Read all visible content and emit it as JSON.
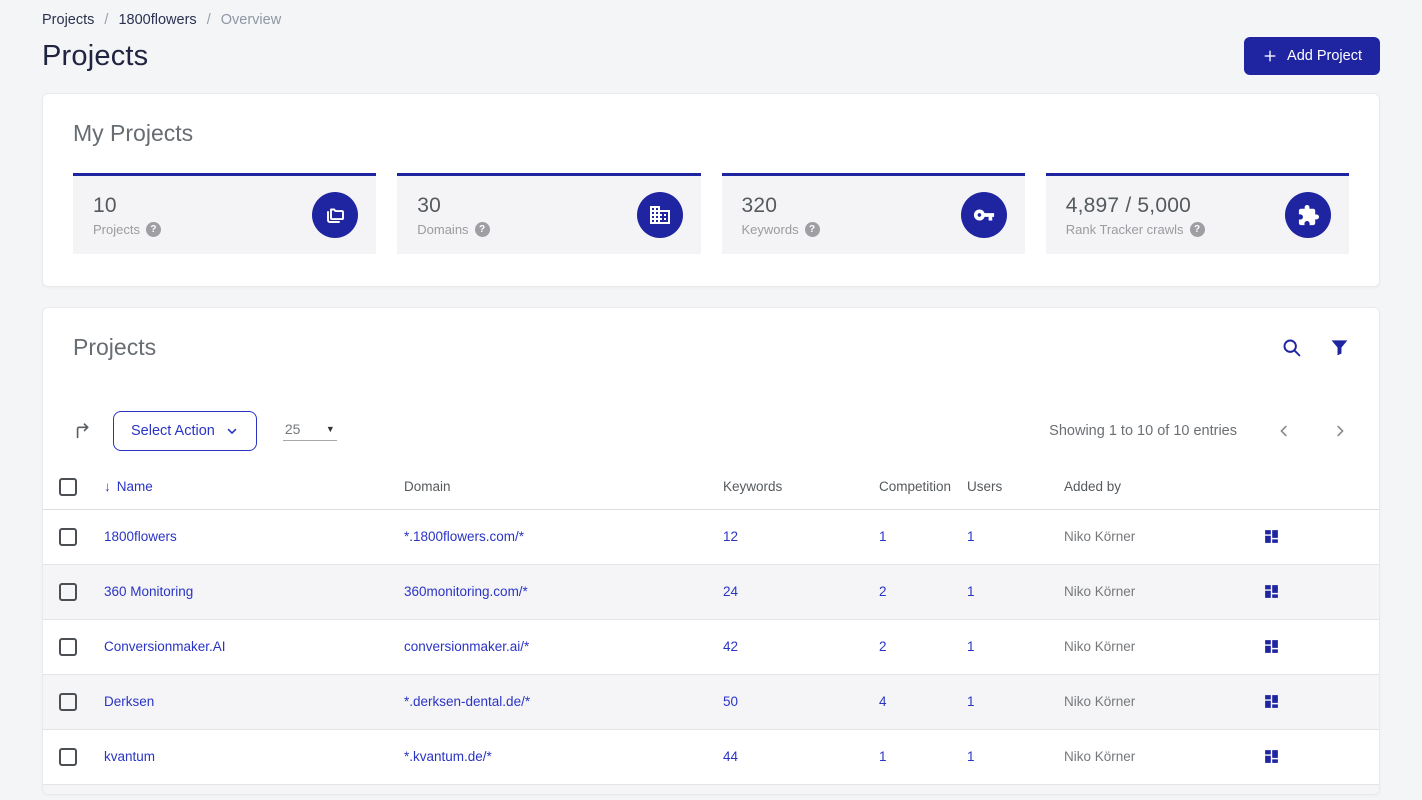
{
  "colors": {
    "primary": "#1f24a0",
    "link": "#2a34c4"
  },
  "breadcrumb": {
    "items": [
      "Projects",
      "1800flowers",
      "Overview"
    ],
    "separator": "/"
  },
  "header": {
    "page_title": "Projects",
    "add_project_label": "Add Project"
  },
  "my_projects": {
    "heading": "My Projects",
    "stats": [
      {
        "value": "10",
        "label": "Projects",
        "icon": "projects-folders-icon"
      },
      {
        "value": "30",
        "label": "Domains",
        "icon": "building-icon"
      },
      {
        "value": "320",
        "label": "Keywords",
        "icon": "key-icon"
      },
      {
        "value": "4,897 / 5,000",
        "label": "Rank Tracker crawls",
        "icon": "puzzle-icon"
      }
    ],
    "help_symbol": "?"
  },
  "projects_panel": {
    "heading": "Projects",
    "select_action_label": "Select Action",
    "page_size": "25",
    "showing_text": "Showing 1 to 10 of 10 entries",
    "table": {
      "headers": {
        "name": "Name",
        "domain": "Domain",
        "keywords": "Keywords",
        "competition": "Competition",
        "users": "Users",
        "added_by": "Added by"
      },
      "sort_arrow": "↓",
      "rows": [
        {
          "name": "1800flowers",
          "domain": "*.1800flowers.com/*",
          "keywords": "12",
          "competition": "1",
          "users": "1",
          "added_by": "Niko Körner"
        },
        {
          "name": "360 Monitoring",
          "domain": "360monitoring.com/*",
          "keywords": "24",
          "competition": "2",
          "users": "1",
          "added_by": "Niko Körner"
        },
        {
          "name": "Conversionmaker.AI",
          "domain": "conversionmaker.ai/*",
          "keywords": "42",
          "competition": "2",
          "users": "1",
          "added_by": "Niko Körner"
        },
        {
          "name": "Derksen",
          "domain": "*.derksen-dental.de/*",
          "keywords": "50",
          "competition": "4",
          "users": "1",
          "added_by": "Niko Körner"
        },
        {
          "name": "kvantum",
          "domain": "*.kvantum.de/*",
          "keywords": "44",
          "competition": "1",
          "users": "1",
          "added_by": "Niko Körner"
        }
      ]
    }
  }
}
